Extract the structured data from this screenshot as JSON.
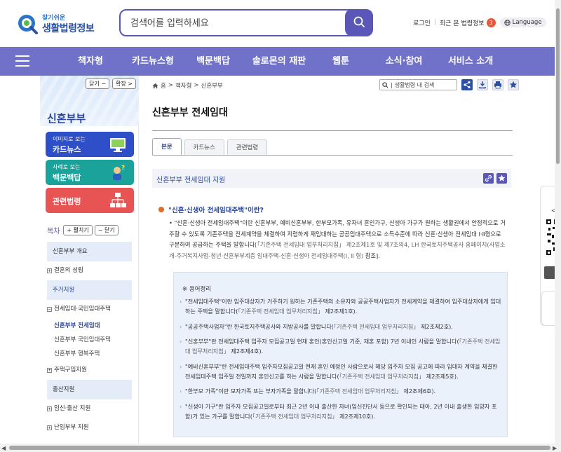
{
  "header": {
    "logo_sub": "찾기쉬운",
    "logo_main": "생활법령정보",
    "search_placeholder": "검색어를 입력하세요",
    "login": "로그인",
    "recent": "최근 본 법령정보",
    "recent_count": "3",
    "language": "Language"
  },
  "nav": {
    "items": [
      "책자형",
      "카드뉴스형",
      "백문백답",
      "솔로몬의 재판",
      "웹툰",
      "소식·참여",
      "서비스 소개"
    ]
  },
  "sidebar": {
    "close": "닫기 −",
    "expand": "확장 >",
    "title": "신혼부부",
    "promos": [
      {
        "small": "이미지로 보는",
        "big": "카드뉴스",
        "color": "#2e4fc7"
      },
      {
        "small": "사례로 보는",
        "big": "백문백답",
        "color": "#1aa39a"
      },
      {
        "big": "관련법령",
        "color": "#e85353"
      }
    ],
    "toc_label": "목차",
    "toc_expand": "+ 펼치기",
    "toc_close": "− 닫기",
    "toc": [
      {
        "type": "sec",
        "label": "신혼부부 개요"
      },
      {
        "type": "l1",
        "box": "+",
        "label": "결혼의 성립"
      },
      {
        "type": "sec",
        "label": "주거지원",
        "blue": true
      },
      {
        "type": "l1",
        "box": "−",
        "label": "전세임대·국민임대주택"
      },
      {
        "type": "l2",
        "label": "신혼부부 전세임대",
        "active": true
      },
      {
        "type": "l2",
        "label": "신혼부부 국민임대주택"
      },
      {
        "type": "l2",
        "label": "신혼부부 행복주택"
      },
      {
        "type": "l1",
        "box": "+",
        "label": "주택구입지원"
      },
      {
        "type": "sec",
        "label": "출산지원"
      },
      {
        "type": "l1",
        "box": "+",
        "label": "임신·출산 지원"
      },
      {
        "type": "l1",
        "box": "+",
        "label": "난임부부 지원"
      }
    ]
  },
  "main": {
    "breadcrumb": [
      "홈",
      "책자형",
      "신혼부부"
    ],
    "search_label": "생활법령 내 검색",
    "title": "신혼부부 전세임대",
    "tabs": [
      "본문",
      "카드뉴스",
      "관련법령"
    ],
    "active_tab": "본문",
    "section_title": "신혼부부 전세임대 지원",
    "question": "\"신혼·신생아 전세임대주택\"이란?",
    "paragraph": "• \"신혼·신생아 전세임대주택\"이란 신혼부부, 예비신혼부부, 한부모가족, 유자녀 혼인가구, 신생아 가구가 원하는 생활권에서 안정적으로 거주할 수 있도록 기존주택을 전세계약을 체결하여 저렴하게 재임대하는 공공임대주택으로 소득수준에 따라 신혼·신생아 전세임대 Ⅰ·Ⅱ형으로 구분하여 공급하는 주택을 말합니다",
    "paragraph_ref": "[「기존주택 전세임대 업무처리지침」 제2조제1호 및 제7조의4, LH 한국토지주택공사 홈페이지(사업소개-주거복지사업-청년·신혼부부계층 임대주택-신혼·신생아 전세임대주택(Ⅰ, Ⅱ 형)",
    "paragraph_end": " 참조].",
    "def_head": "※ 용어정리",
    "definitions": [
      {
        "text": "\"전세임대주택\"이란 입주대상자가 거주하기 원하는 기존주택의 소유자와 공공주택사업자가 전세계약을 체결하여 입주대상자에게 임대하는 주택을 말합니다(",
        "ref": "「기존주택 전세임대 업무처리지침」",
        "tail": " 제2조제1호)."
      },
      {
        "text": "\"공공주택사업자\"란 한국토지주택공사와 지방공사를 말합니다(",
        "ref": "「기존주택 전세임대 업무처리지침」",
        "tail": " 제2조제2호)."
      },
      {
        "text": "\"신혼부부\"란 전세임대주택 입주자 모집공고일 현재 혼인(혼인신고일 기준, 재혼 포함) 7년 이내인 사람을 말합니다(",
        "ref": "「기존주택 전세임대 업무처리지침」",
        "tail": " 제2조제4호)."
      },
      {
        "text": "\"예비신혼부부\"란 전세임대주택 입주자모집공고일 현재 혼인 예정인 사람으로서 해당 입주자 모집 공고에 따라 임대차 계약을 체결한 전세임대주택 입주일 전일까지 혼인신고를 하는 사람을 말합니다(",
        "ref": "「기존주택 전세임대 업무처리지침」",
        "tail": " 제2조제5호)."
      },
      {
        "text": "\"한부모 가족\"이란 모자가족 또는 부자가족을 말합니다(",
        "ref": "「기존주택 전세임대 업무처리지침」",
        "tail": " 제2조제6호)."
      },
      {
        "text": "\"신생아 가구\"란 입주자 모집공고일로부터 최근 2년 이내 출산한 자녀(임신진단서 등으로 확인되는 태아, 2년 이내 출생한 입양자 포함)가 있는 가구를 말합니다(",
        "ref": "「기존주택 전세임대 업무처리지침」",
        "tail": " 제2조제10호)."
      }
    ]
  },
  "colors": {
    "nav": "#6f72c8",
    "accent": "#5b57b8",
    "link_blue": "#2a47a0"
  }
}
